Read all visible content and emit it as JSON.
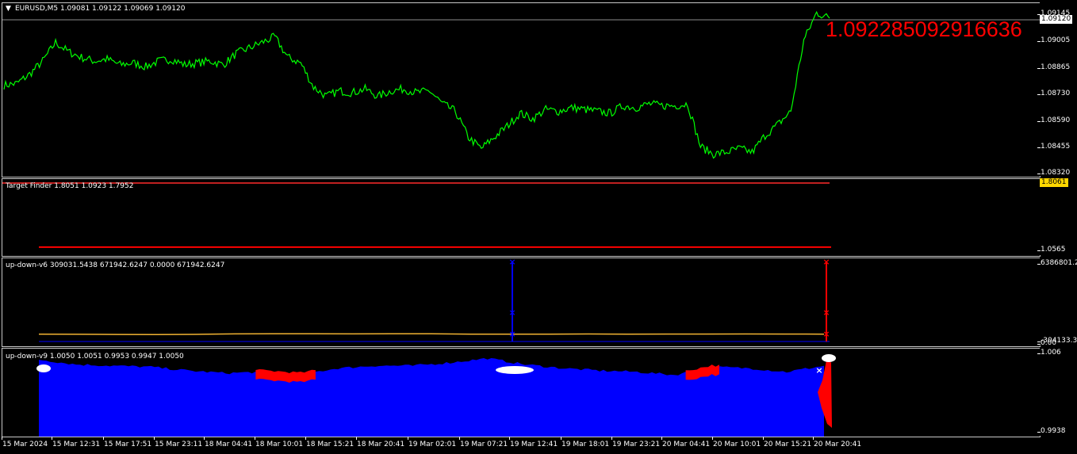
{
  "main": {
    "symbol_label": "EURUSD,M5  1.09081 1.09122 1.09069 1.09120",
    "overlay_value": "1.092285092916636",
    "price_tag": "1.09120",
    "y_ticks": [
      "1.09145",
      "1.09005",
      "1.08865",
      "1.08730",
      "1.08590",
      "1.08455",
      "1.08320"
    ],
    "line_color": "#00ff00",
    "overlay_color": "#ff0000"
  },
  "target_finder": {
    "label": "Target Finder 1.8051 1.0923 1.7952",
    "value_tag": "1.8061",
    "y_ticks": [
      "1.0565"
    ]
  },
  "updown_v6": {
    "label": "up-down-v6 309031.5438 671942.6247 0.0000 671942.6247",
    "y_ticks": [
      "6386801.2",
      "-304133.3",
      "0.00"
    ]
  },
  "updown_v9": {
    "label": "up-down-v9 1.0050 1.0051 0.9953 0.9947 1.0050",
    "y_ticks": [
      "1.006",
      "0.9938"
    ]
  },
  "time_axis": [
    "15 Mar 2024",
    "15 Mar 12:31",
    "15 Mar 17:51",
    "15 Mar 23:11",
    "18 Mar 04:41",
    "18 Mar 10:01",
    "18 Mar 15:21",
    "18 Mar 20:41",
    "19 Mar 02:01",
    "19 Mar 07:21",
    "19 Mar 12:41",
    "19 Mar 18:01",
    "19 Mar 23:21",
    "20 Mar 04:41",
    "20 Mar 10:01",
    "20 Mar 15:21",
    "20 Mar 20:41"
  ],
  "chart_data": [
    {
      "type": "line",
      "title": "EURUSD,M5",
      "series": [
        {
          "name": "EURUSD,M5",
          "values": [
            1.0876,
            1.0877,
            1.0882,
            1.0889,
            1.0899,
            1.0894,
            1.0891,
            1.0889,
            1.089,
            1.0887,
            1.0888,
            1.0886,
            1.0889,
            1.089,
            1.0887,
            1.0888,
            1.0889,
            1.0887,
            1.0893,
            1.0896,
            1.0899,
            1.0902,
            1.0891,
            1.0888,
            1.0875,
            1.087,
            1.0873,
            1.0872,
            1.0874,
            1.087,
            1.0873,
            1.0874,
            1.0872,
            1.0873,
            1.0866,
            1.0862,
            1.0848,
            1.0842,
            1.0848,
            1.0854,
            1.0861,
            1.0858,
            1.0863,
            1.0862,
            1.0864,
            1.0863,
            1.0862,
            1.0861,
            1.0865,
            1.0864,
            1.0866,
            1.0865,
            1.0865,
            1.0866,
            1.0843,
            1.0839,
            1.084,
            1.0842,
            1.084,
            1.0849,
            1.0855,
            1.0862,
            1.09,
            1.0915,
            1.0912
          ]
        }
      ],
      "ylim": [
        1.0832,
        1.0915
      ]
    },
    {
      "type": "line",
      "title": "Target Finder",
      "series": [
        {
          "name": "Target Finder",
          "values": [
            1.0923,
            1.0923,
            1.0923,
            1.0923,
            1.0923,
            1.0923,
            1.0923,
            1.0923,
            1.0923,
            1.0923,
            1.0923,
            1.0923
          ]
        }
      ],
      "ylim": [
        1.0565,
        1.8061
      ]
    },
    {
      "type": "line",
      "title": "up-down-v6",
      "series": [
        {
          "name": "up-down-v6",
          "values": [
            309031,
            300000,
            285000,
            282000,
            290000,
            330000,
            340000,
            338000,
            333000,
            336000,
            340000,
            310000,
            305000,
            310000,
            322000,
            315000,
            318000,
            321000,
            323000,
            318000,
            309031
          ]
        }
      ],
      "spikes": [
        {
          "x_label": "19 Mar 12:41",
          "value": 6386801.2,
          "color": "blue"
        },
        {
          "x_label": "20 Mar 20:41",
          "value": 6386801.2,
          "color": "red"
        }
      ],
      "ylim": [
        -304133.3,
        6386801.2
      ]
    },
    {
      "type": "bar",
      "title": "up-down-v9",
      "series": [
        {
          "name": "up-down-v9",
          "values": [
            1.005,
            1.0042,
            1.004,
            1.0038,
            1.0032,
            1.0028,
            1.003,
            1.0026,
            1.0036,
            1.004,
            1.004,
            1.0045,
            1.0052,
            1.0042,
            1.0036,
            1.0032,
            1.003,
            1.0025,
            1.0038,
            1.0036,
            1.003,
            1.004
          ]
        }
      ],
      "ylim": [
        0.9938,
        1.006
      ]
    }
  ]
}
